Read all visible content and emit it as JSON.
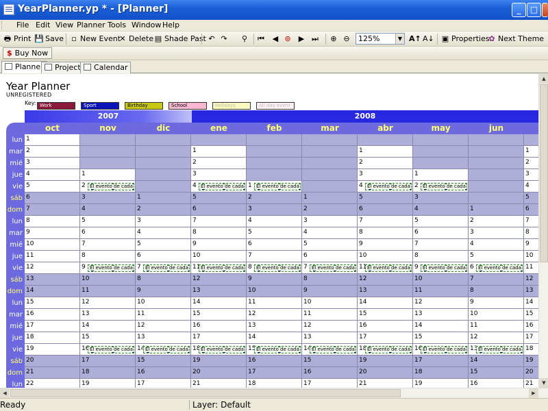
{
  "window": {
    "title": "YearPlanner.yp * - [Planner]"
  },
  "window_buttons": {
    "minimize": "_",
    "maximize": "□",
    "close": "X"
  },
  "menu": [
    "File",
    "Edit",
    "View",
    "Planner",
    "Tools",
    "Window",
    "Help"
  ],
  "toolbar": {
    "print": "Print",
    "save": "Save",
    "new_event": "New Event",
    "delete": "Delete",
    "shade_past": "Shade Past",
    "zoom": "125%",
    "properties": "Properties",
    "next_theme": "Next Theme"
  },
  "toolbar2": {
    "buy_now": "Buy Now"
  },
  "tabs": [
    "Planner",
    "Project",
    "Calendar"
  ],
  "planner": {
    "title": "Year Planner",
    "registration": "UNREGISTERED",
    "key_label": "Key:",
    "keys": [
      {
        "label": "Work",
        "color": "#8a1a3c",
        "text_color": "#ffffff"
      },
      {
        "label": "Sport",
        "color": "#0a14b8",
        "text_color": "#ffffff"
      },
      {
        "label": "Birthday",
        "color": "#c8c814",
        "text_color": "#000000"
      },
      {
        "label": "School",
        "color": "#f8b8d0",
        "text_color": "#000000"
      },
      {
        "label": "Holidays",
        "color": "#f8f8c0",
        "text_color": "#c0c0a0"
      },
      {
        "label": "All day event",
        "color": "#fdf0f4",
        "text_color": "#c0c0c0"
      }
    ],
    "years": [
      "2007",
      "2008"
    ],
    "months": [
      "oct",
      "nov",
      "dic",
      "ene",
      "feb",
      "mar",
      "abr",
      "may",
      "jun"
    ],
    "days_of_week": [
      "lun",
      "mar",
      "mié",
      "jue",
      "vie",
      "sáb",
      "dom",
      "lun",
      "mar",
      "mié",
      "jue",
      "vie",
      "sáb",
      "dom",
      "lun",
      "mar",
      "mié",
      "jue",
      "vie",
      "sáb",
      "dom",
      "lun"
    ],
    "event_text": "El evento de cada",
    "columns": [
      {
        "days": [
          1,
          2,
          3,
          4,
          5,
          6,
          7,
          8,
          9,
          10,
          11,
          12,
          13,
          14,
          15,
          16,
          17,
          18,
          19,
          20,
          21,
          22
        ],
        "events": []
      },
      {
        "days": [
          null,
          null,
          null,
          1,
          2,
          3,
          4,
          5,
          6,
          7,
          8,
          9,
          10,
          11,
          12,
          13,
          14,
          15,
          16,
          17,
          18,
          19
        ],
        "events": [
          4,
          11,
          18
        ]
      },
      {
        "days": [
          null,
          null,
          null,
          null,
          null,
          1,
          2,
          3,
          4,
          5,
          6,
          7,
          8,
          9,
          10,
          11,
          12,
          13,
          14,
          15,
          16,
          17
        ],
        "events": [
          11,
          18
        ]
      },
      {
        "days": [
          null,
          1,
          2,
          3,
          4,
          5,
          6,
          7,
          8,
          9,
          10,
          11,
          12,
          13,
          14,
          15,
          16,
          17,
          18,
          19,
          20,
          21
        ],
        "events": [
          4,
          11,
          18
        ]
      },
      {
        "days": [
          null,
          null,
          null,
          null,
          1,
          2,
          3,
          4,
          5,
          6,
          7,
          8,
          9,
          10,
          11,
          12,
          13,
          14,
          15,
          16,
          17,
          18
        ],
        "events": [
          4,
          11,
          18
        ]
      },
      {
        "days": [
          null,
          null,
          null,
          null,
          null,
          1,
          2,
          3,
          4,
          5,
          6,
          7,
          8,
          9,
          10,
          11,
          12,
          13,
          14,
          15,
          16,
          17
        ],
        "events": [
          11,
          18
        ]
      },
      {
        "days": [
          null,
          1,
          2,
          3,
          4,
          5,
          6,
          7,
          8,
          9,
          10,
          11,
          12,
          13,
          14,
          15,
          16,
          17,
          18,
          19,
          20,
          21
        ],
        "events": [
          4,
          11,
          18
        ]
      },
      {
        "days": [
          null,
          null,
          null,
          1,
          2,
          3,
          4,
          5,
          6,
          7,
          8,
          9,
          10,
          11,
          12,
          13,
          14,
          15,
          16,
          17,
          18,
          19
        ],
        "events": [
          4,
          11,
          18
        ]
      },
      {
        "days": [
          null,
          null,
          null,
          null,
          null,
          null,
          1,
          2,
          3,
          4,
          5,
          6,
          7,
          8,
          9,
          10,
          11,
          12,
          13,
          14,
          15,
          16
        ],
        "events": [
          11,
          18
        ]
      },
      {
        "days": [
          null,
          1,
          2,
          3,
          4,
          5,
          6,
          7,
          8,
          9,
          10,
          11,
          12,
          13,
          14,
          15,
          16,
          17,
          18,
          19,
          20,
          21
        ],
        "events": []
      }
    ]
  },
  "status": {
    "left": "Ready",
    "layer": "Layer: Default"
  }
}
